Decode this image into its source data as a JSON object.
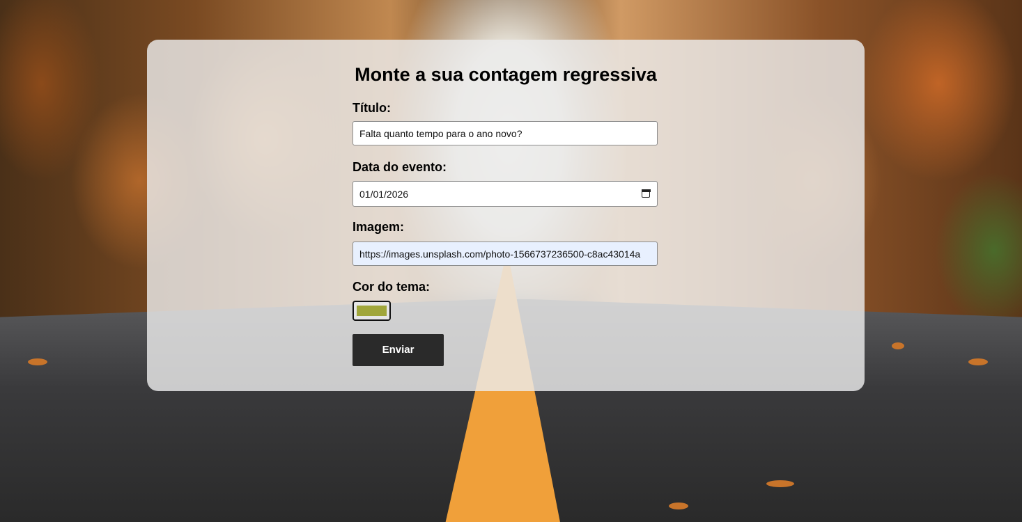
{
  "page": {
    "heading": "Monte a sua contagem regressiva"
  },
  "form": {
    "title_label": "Título:",
    "title_value": "Falta quanto tempo para o ano novo?",
    "date_label": "Data do evento:",
    "date_value": "01/01/2026",
    "image_label": "Imagem:",
    "image_value": "https://images.unsplash.com/photo-1566737236500-c8ac43014a",
    "color_label": "Cor do tema:",
    "color_value": "#a0a63a",
    "submit_label": "Enviar"
  },
  "icons": {
    "date_picker": "calendar-icon"
  }
}
